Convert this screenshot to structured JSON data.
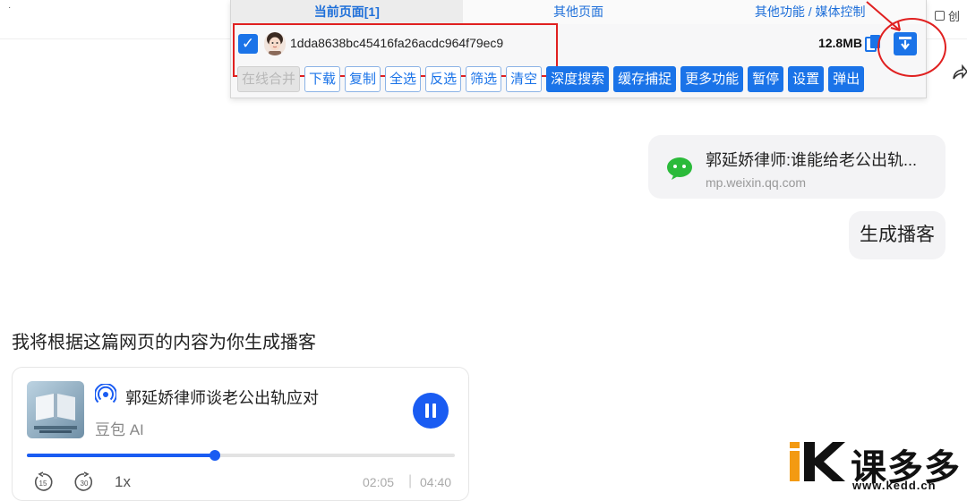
{
  "top_strip": {
    "dot": "·",
    "right_label": "创"
  },
  "sniffer": {
    "tabs": [
      "当前页面[1]",
      "其他页面",
      "其他功能 / 媒体控制"
    ],
    "item": {
      "checked": true,
      "file_name": "1dda8638bc45416fa26acdc964f79ec9",
      "file_size": "12.8MB"
    },
    "buttons": [
      "在线合并",
      "下载",
      "复制",
      "全选",
      "反选",
      "筛选",
      "清空",
      "深度搜索",
      "缓存捕捉",
      "更多功能",
      "暂停",
      "设置",
      "弹出"
    ],
    "button_styles": [
      "disabled",
      "outline",
      "outline",
      "outline",
      "outline",
      "outline",
      "outline",
      "solid",
      "solid",
      "solid",
      "solid",
      "solid",
      "solid"
    ]
  },
  "chat": {
    "link_card": {
      "title": "郭延娇律师:谁能给老公出轨...",
      "url": "mp.weixin.qq.com"
    },
    "user_message": "生成播客",
    "reply": "我将根据这篇网页的内容为你生成播客"
  },
  "podcast": {
    "title": "郭延娇律师谈老公出轨应对",
    "source": "豆包 AI",
    "progress": 0.44,
    "skip_back": "15",
    "skip_forward": "30",
    "speed": "1x",
    "current_time": "02:05",
    "separator": "|",
    "total_time": "04:40"
  },
  "watermark": {
    "brand": "课多多",
    "url": "www.kedd.cn"
  },
  "colors": {
    "accent": "#1a73e8",
    "annotation": "#e02020",
    "play_blue": "#1a5cf2"
  }
}
